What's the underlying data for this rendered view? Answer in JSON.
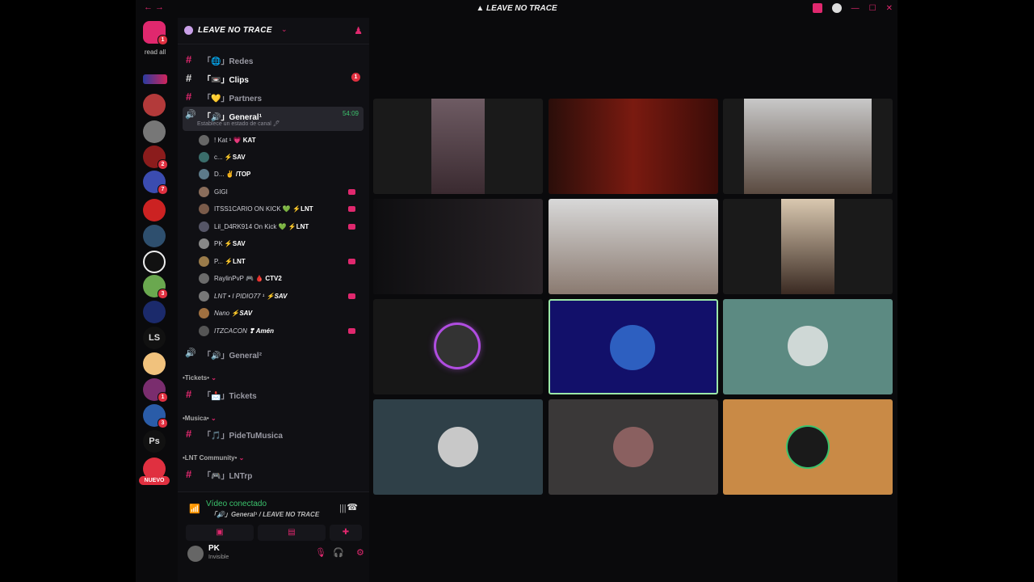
{
  "titlebar": {
    "back_icon": "arrow-left-icon",
    "title": "LEAVE NO TRACE",
    "inbox_icon": "inbox-icon",
    "help_icon": "help-icon"
  },
  "rail": {
    "read_all_label": "read all",
    "home_badge": "1",
    "badges": {
      "s6": "2",
      "s7": "7",
      "s13": "3",
      "s16": "1",
      "s17": "3"
    },
    "text_servers": {
      "ls": "LS",
      "ps": "Ps"
    },
    "new_label": "NUEVO"
  },
  "server": {
    "name": "LEAVE NO TRACE"
  },
  "channels": {
    "redes": {
      "name": "「🌐」Redes"
    },
    "clips": {
      "name": "「📼」Clips",
      "unread": "1"
    },
    "partners": {
      "name": "「💛」Partners"
    },
    "general": {
      "name": "「🔊」General¹",
      "timer": "54:09",
      "status_hint": "Establece un estado de canal 🖊"
    },
    "general2": {
      "name": "「🔊」General²"
    },
    "tickets": {
      "name": "「📩」Tickets"
    },
    "pidetumusica": {
      "name": "「🎵」PideTuMusica"
    },
    "lntrp": {
      "name": "「🎮」LNTrp"
    }
  },
  "categories": {
    "tickets": "•Tickets•",
    "musica": "•Musica•",
    "community": "•LNT Community•"
  },
  "voice_users": [
    {
      "name": "! Kat ¹",
      "tag": "💗 KAT"
    },
    {
      "name": "c...",
      "tag": "⚡SAV"
    },
    {
      "name": "D...",
      "tag": "✌ /TOP"
    },
    {
      "name": "GIGI",
      "tag": ""
    },
    {
      "name": "ITSS1CARIO ON KICK 💚",
      "tag": "⚡LNT"
    },
    {
      "name": "Lil_D4RK914 On Kick 💚",
      "tag": "⚡LNT"
    },
    {
      "name": "PK",
      "tag": "⚡SAV"
    },
    {
      "name": "P...",
      "tag": "⚡LNT"
    },
    {
      "name": "RaylinPvP 🎮",
      "tag": "🩸 CTV2"
    },
    {
      "name": "LNT • I PIDIO77 ¹",
      "tag": "⚡SAV"
    },
    {
      "name": "Nano",
      "tag": "⚡SAV"
    },
    {
      "name": "ITZCACON",
      "tag": "❣ Amén"
    }
  ],
  "voice_panel": {
    "status": "Vídeo conectado",
    "channel": "「🔊」General¹ / LEAVE NO TRACE",
    "user_name": "PK",
    "user_status": "Invisible"
  },
  "colors": {
    "accent": "#e0286e",
    "connected": "#3bc26c",
    "speaking_outline": "#9be7a8"
  }
}
